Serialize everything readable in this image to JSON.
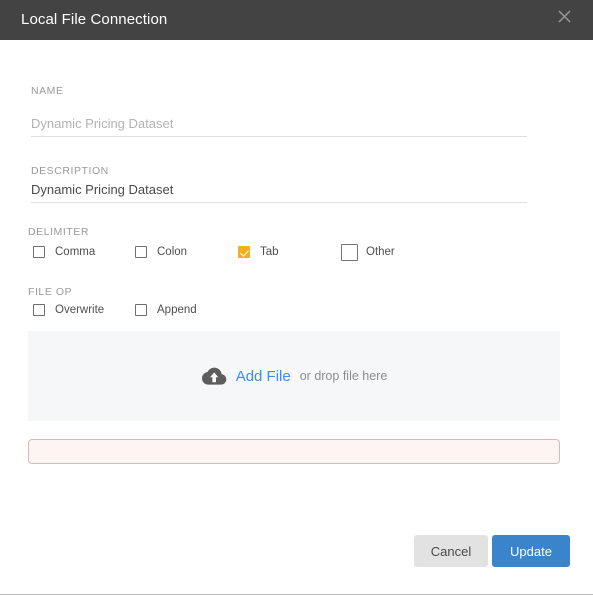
{
  "dialog": {
    "title": "Local File Connection",
    "close_icon": "close-icon"
  },
  "form": {
    "name": {
      "label": "NAME",
      "value": "",
      "placeholder": "Dynamic Pricing Dataset"
    },
    "description": {
      "label": "DESCRIPTION",
      "value": "Dynamic Pricing Dataset",
      "placeholder": ""
    },
    "delimiter": {
      "label": "DELIMITER",
      "options": [
        {
          "label": "Comma",
          "checked": false
        },
        {
          "label": "Colon",
          "checked": false
        },
        {
          "label": "Tab",
          "checked": true
        },
        {
          "label": "Other",
          "checked": false
        }
      ]
    },
    "file_op": {
      "label": "FILE OP",
      "options": [
        {
          "label": "Overwrite",
          "checked": false
        },
        {
          "label": "Append",
          "checked": false
        }
      ]
    }
  },
  "dropzone": {
    "icon": "cloud-upload-icon",
    "link_label": "Add File",
    "hint": "or drop file here"
  },
  "error": {
    "message": ""
  },
  "footer": {
    "cancel_label": "Cancel",
    "update_label": "Update"
  },
  "colors": {
    "header_bg": "#434343",
    "accent_checkbox": "#f2b01e",
    "link_blue": "#3b8cef",
    "primary_button": "#3a84cc",
    "cancel_button": "#e2e2e2",
    "dropzone_bg": "#f6f7f9",
    "error_bg": "#fdf4f4",
    "error_border": "#e2b6b6"
  }
}
